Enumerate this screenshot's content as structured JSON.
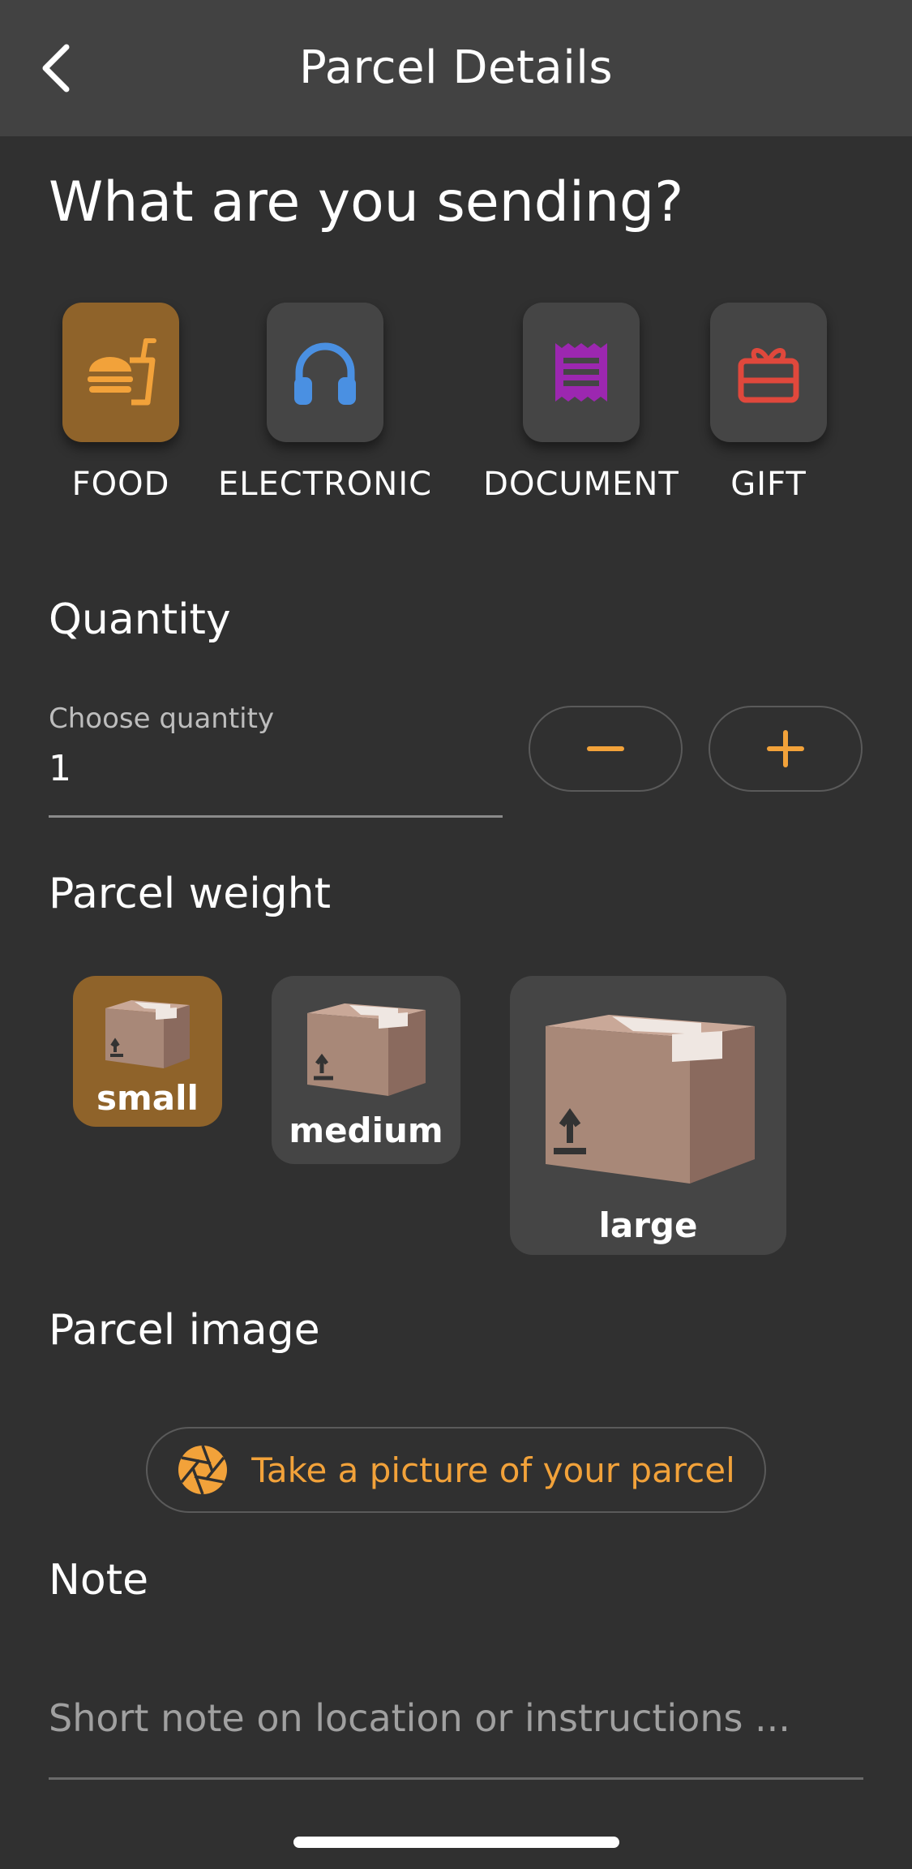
{
  "header": {
    "title": "Parcel Details",
    "back_icon": "chevron-left-icon"
  },
  "category": {
    "heading": "What are you sending?",
    "selected": "FOOD",
    "items": [
      {
        "label": "FOOD",
        "icon": "fastfood-icon",
        "color": "#f2a23a"
      },
      {
        "label": "ELECTRONIC",
        "icon": "headphones-icon",
        "color": "#4a90e2"
      },
      {
        "label": "DOCUMENT",
        "icon": "receipt-icon",
        "color": "#9c27b0"
      },
      {
        "label": "GIFT",
        "icon": "gift-icon",
        "color": "#e0483c"
      }
    ]
  },
  "quantity": {
    "heading": "Quantity",
    "caption": "Choose quantity",
    "value": "1",
    "decrement_icon": "minus-icon",
    "increment_icon": "plus-icon"
  },
  "weight": {
    "heading": "Parcel weight",
    "selected": "small",
    "options": [
      {
        "label": "small",
        "icon": "box-icon"
      },
      {
        "label": "medium",
        "icon": "box-icon"
      },
      {
        "label": "large",
        "icon": "box-icon"
      }
    ]
  },
  "image": {
    "heading": "Parcel image",
    "button_label": "Take a picture of your parcel",
    "button_icon": "camera-shutter-icon"
  },
  "note": {
    "heading": "Note",
    "placeholder": "Short note on location or instructions ..."
  },
  "colors": {
    "background": "#303030",
    "appbar": "#424242",
    "card": "#454545",
    "accent": "#f2a23a",
    "selected_card": "#8f632a"
  }
}
